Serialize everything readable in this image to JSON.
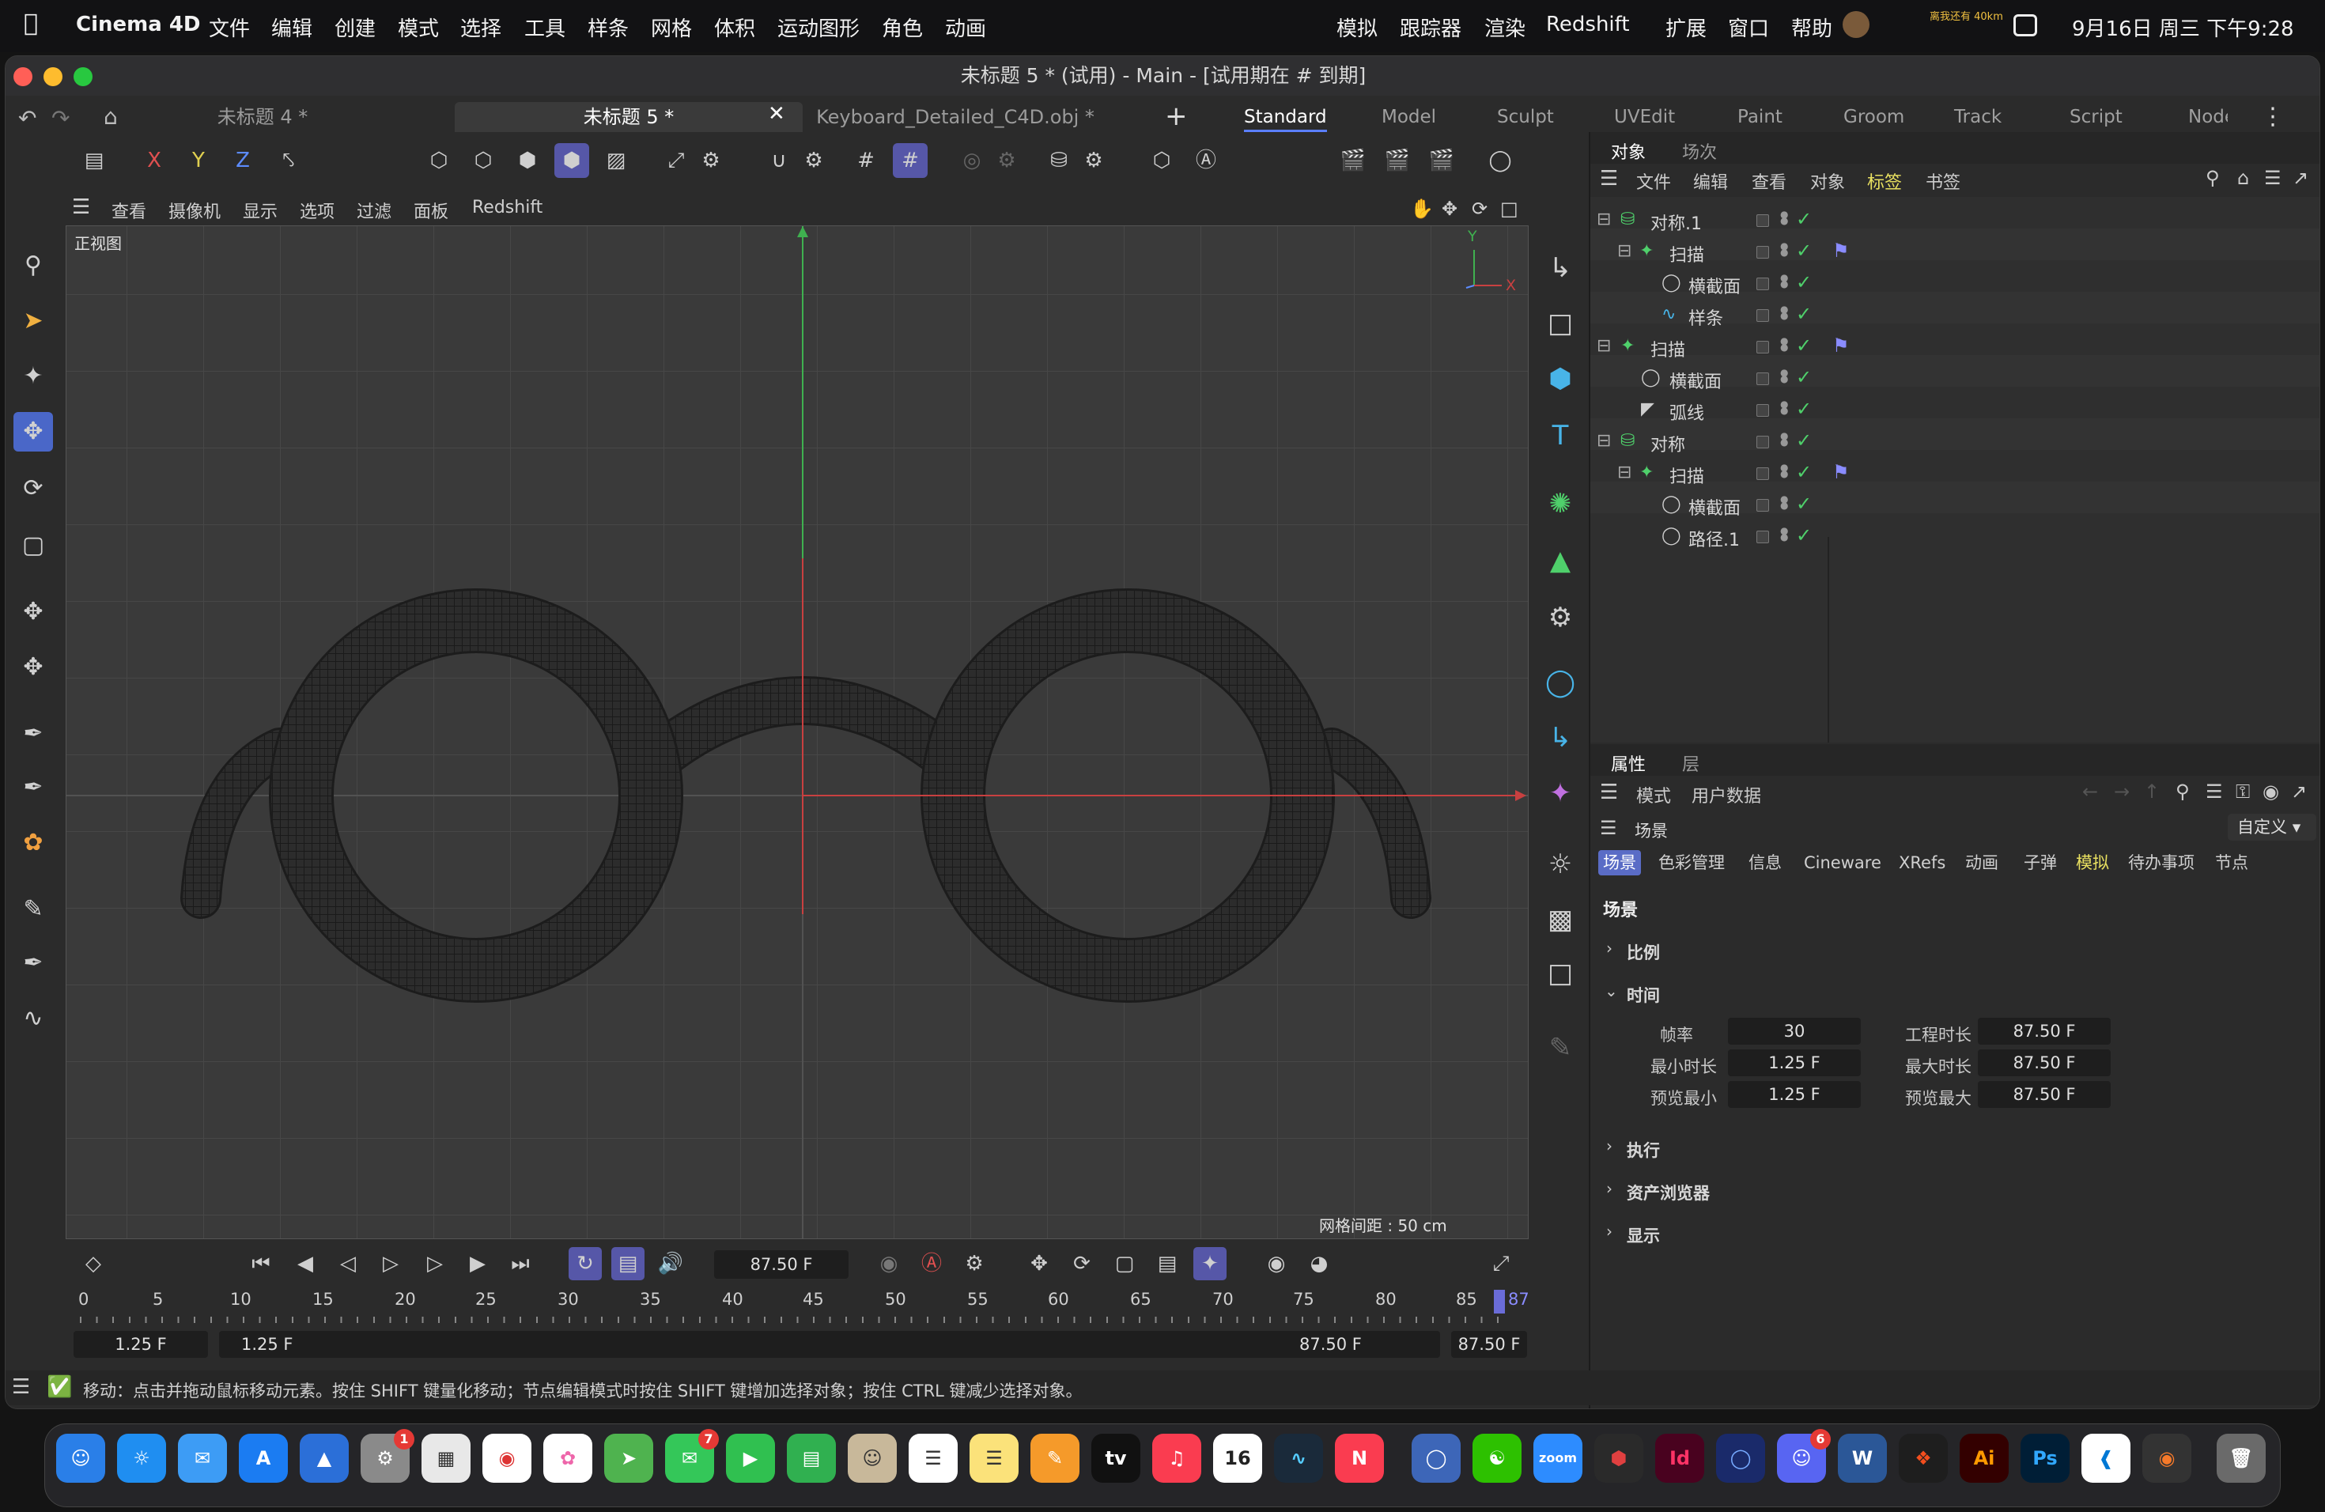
{
  "menubar": {
    "app": "Cinema 4D",
    "items": [
      "文件",
      "编辑",
      "创建",
      "模式",
      "选择",
      "工具",
      "样条",
      "网格",
      "体积",
      "运动图形",
      "角色",
      "动画"
    ],
    "right_items": [
      "模拟",
      "跟踪器",
      "渲染",
      "Redshift",
      "扩展",
      "窗口",
      "帮助"
    ],
    "tray_text": "离我还有 40km",
    "datetime": "9月16日 周三  下午9:28"
  },
  "window": {
    "title": "未标题 5 * (试用) - Main - [试用期在 # 到期]",
    "tabs": [
      "未标题 4 *",
      "未标题 5 *",
      "Keyboard_Detailed_C4D.obj *"
    ],
    "workspaces": [
      "Standard",
      "Model",
      "Sculpt",
      "UVEdit",
      "Paint",
      "Groom",
      "Track",
      "Script",
      "Node"
    ],
    "axes": [
      "X",
      "Y",
      "Z"
    ]
  },
  "viewport": {
    "menu": [
      "查看",
      "摄像机",
      "显示",
      "选项",
      "过滤",
      "面板",
      "Redshift"
    ],
    "label": "正视图",
    "grid_spacing": "网格间距 : 50 cm",
    "axis_x": "X",
    "axis_y": "Y"
  },
  "object_manager": {
    "tabs": [
      "对象",
      "场次"
    ],
    "menu": [
      "文件",
      "编辑",
      "查看",
      "对象",
      "标签",
      "书签"
    ],
    "rows": [
      {
        "name": "对称.1",
        "icon": "symmetry-icon"
      },
      {
        "name": "扫描",
        "icon": "sweep-icon"
      },
      {
        "name": "横截面",
        "icon": "circle-icon"
      },
      {
        "name": "样条",
        "icon": "spline-icon"
      },
      {
        "name": "扫描",
        "icon": "sweep-icon"
      },
      {
        "name": "横截面",
        "icon": "circle-icon"
      },
      {
        "name": "弧线",
        "icon": "arc-icon"
      },
      {
        "name": "对称",
        "icon": "symmetry-icon"
      },
      {
        "name": "扫描",
        "icon": "sweep-icon"
      },
      {
        "name": "横截面",
        "icon": "circle-icon"
      },
      {
        "name": "路径.1",
        "icon": "circle-icon"
      }
    ]
  },
  "attributes": {
    "tabs": [
      "属性",
      "层"
    ],
    "menu": [
      "模式",
      "用户数据"
    ],
    "context": "场景",
    "preset": "自定义",
    "subtabs": [
      "场景",
      "色彩管理",
      "信息",
      "Cineware",
      "XRefs",
      "动画",
      "子弹",
      "模拟",
      "待办事项",
      "节点"
    ],
    "heading": "场景",
    "sections": {
      "scale": "比例",
      "time": "时间",
      "execute": "执行",
      "asset_browser": "资产浏览器",
      "display": "显示"
    },
    "fields": {
      "fps_label": "帧率",
      "fps": "30",
      "proj_len_label": "工程时长",
      "proj_len": "87.50 F",
      "min_time_label": "最小时长",
      "min_time": "1.25 F",
      "max_time_label": "最大时长",
      "max_time": "87.50 F",
      "prev_min_label": "预览最小",
      "prev_min": "1.25 F",
      "prev_max_label": "预览最大",
      "prev_max": "87.50 F"
    }
  },
  "timeline": {
    "current_frame": "87.50 F",
    "ticks": [
      "0",
      "5",
      "10",
      "15",
      "20",
      "25",
      "30",
      "35",
      "40",
      "45",
      "50",
      "55",
      "60",
      "65",
      "70",
      "75",
      "80",
      "85"
    ],
    "end_tick": "87",
    "range_start_a": "1.25 F",
    "range_start_b": "1.25 F",
    "range_end_a": "87.50 F",
    "range_end_b": "87.50 F"
  },
  "status": {
    "message": "移动：点击并拖动鼠标移动元素。按住 SHIFT 键量化移动；节点编辑模式时按住 SHIFT 键增加选择对象；按住 CTRL 键减少选择对象。"
  },
  "dock": {
    "badges": {
      "settings": "1",
      "messages": "7",
      "discord": "6"
    },
    "calendar_day": "16",
    "tv_label": "tv",
    "zoom_label": "zoom",
    "id_label": "Id",
    "ai_label": "Ai",
    "ps_label": "Ps",
    "w_label": "W"
  },
  "colors": {
    "accent": "#5657a8",
    "check": "#4fd06b",
    "axis_x": "#d04040",
    "axis_y": "#3fb04f"
  }
}
